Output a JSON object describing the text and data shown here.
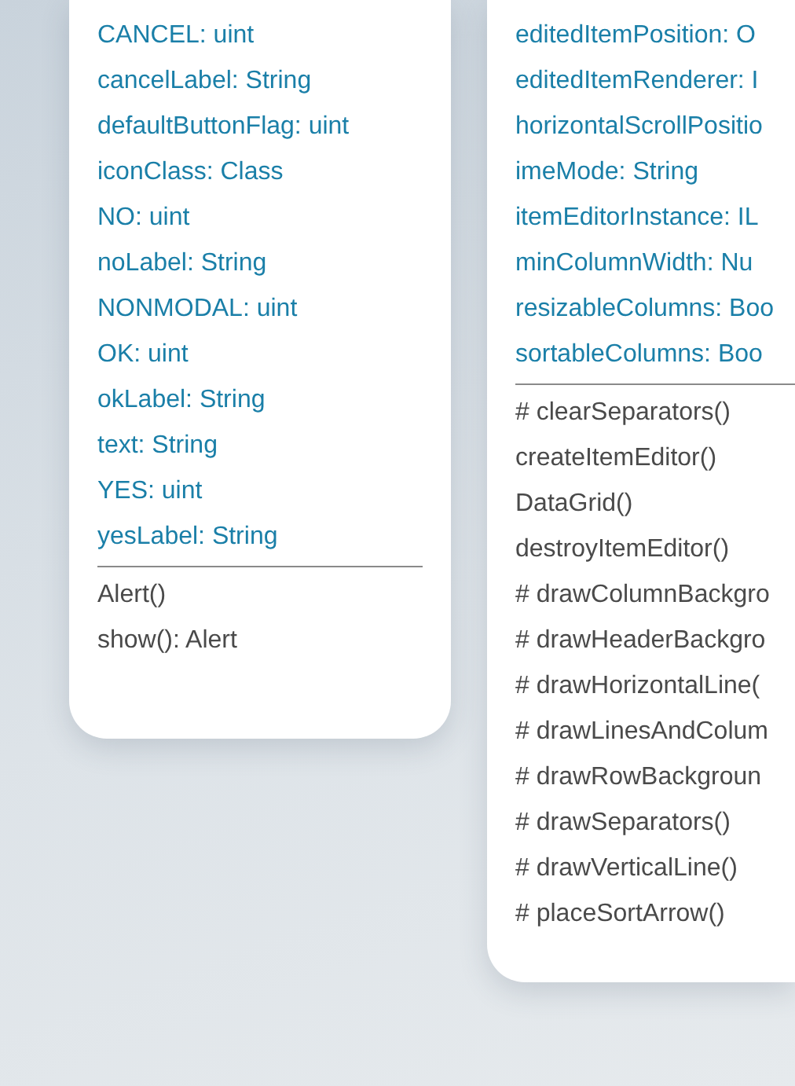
{
  "classes": [
    {
      "attributes": [
        "CANCEL: uint",
        "cancelLabel: String",
        "defaultButtonFlag: uint",
        "iconClass: Class",
        "NO: uint",
        "noLabel: String",
        "NONMODAL: uint",
        "OK: uint",
        "okLabel: String",
        "text: String",
        "YES: uint",
        "yesLabel: String"
      ],
      "operations": [
        "Alert()",
        "show(): Alert"
      ]
    },
    {
      "attributes": [
        "editedItemPosition: O",
        "editedItemRenderer: I",
        "horizontalScrollPositio",
        "imeMode: String",
        "itemEditorInstance: IL",
        "minColumnWidth: Nu",
        "resizableColumns: Boo",
        "sortableColumns: Boo"
      ],
      "operations": [
        "# clearSeparators()",
        "createItemEditor()",
        "DataGrid()",
        "destroyItemEditor()",
        "# drawColumnBackgro",
        "# drawHeaderBackgro",
        "# drawHorizontalLine(",
        "# drawLinesAndColum",
        "# drawRowBackgroun",
        "# drawSeparators()",
        "# drawVerticalLine()",
        "# placeSortArrow()"
      ]
    }
  ]
}
